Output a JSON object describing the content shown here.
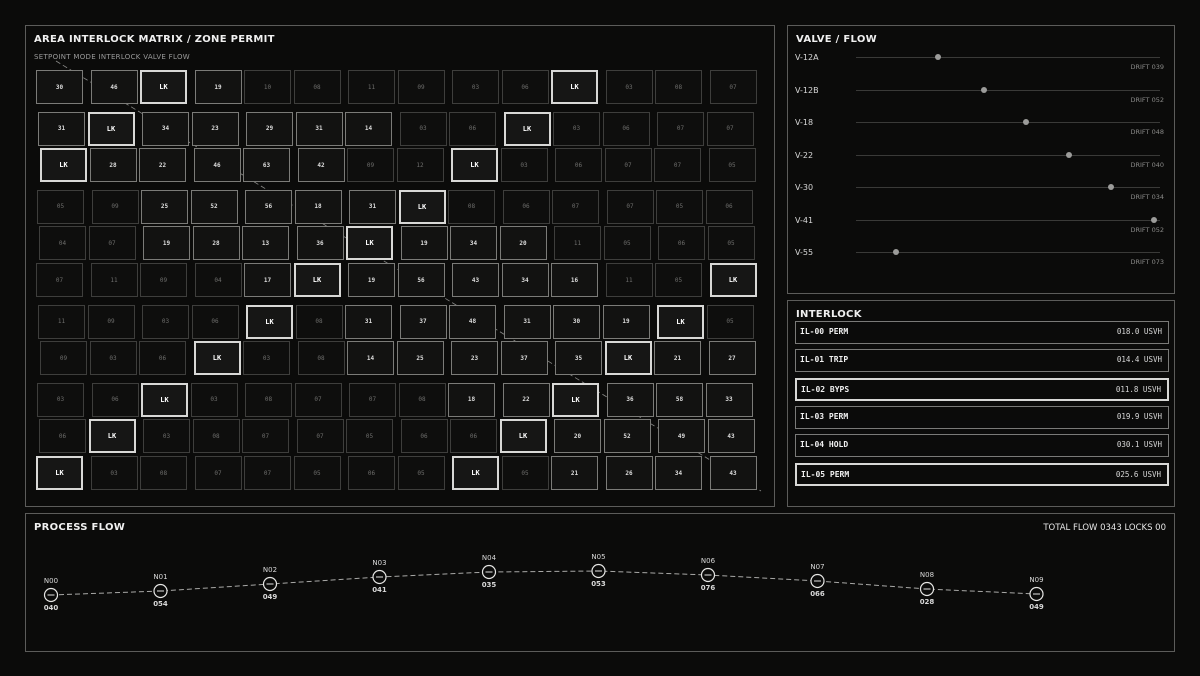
{
  "matrix": {
    "title": "AREA INTERLOCK MATRIX / ZONE PERMIT",
    "subtitle": "SETPOINT  MODE  INTERLOCK  VALVE  FLOW",
    "rows": [
      [
        "30",
        "46",
        "LK",
        "19",
        "10",
        "08",
        "11",
        "09",
        "03",
        "06",
        "LK",
        "03",
        "08",
        "07"
      ],
      [
        "31",
        "LK",
        "34",
        "23",
        "29",
        "31",
        "14",
        "03",
        "06",
        "LK",
        "03",
        "06",
        "07",
        "07"
      ],
      [
        "LK",
        "28",
        "22",
        "46",
        "63",
        "42",
        "09",
        "12",
        "LK",
        "03",
        "06",
        "07",
        "07",
        "05"
      ],
      [
        "05",
        "09",
        "25",
        "52",
        "56",
        "18",
        "31",
        "LK",
        "08",
        "06",
        "07",
        "07",
        "05",
        "06"
      ],
      [
        "04",
        "07",
        "19",
        "28",
        "13",
        "36",
        "LK",
        "19",
        "34",
        "20",
        "11",
        "05",
        "06",
        "05"
      ],
      [
        "07",
        "11",
        "09",
        "04",
        "17",
        "LK",
        "19",
        "56",
        "43",
        "34",
        "16",
        "11",
        "05",
        "LK"
      ],
      [
        "11",
        "09",
        "03",
        "06",
        "LK",
        "08",
        "31",
        "37",
        "48",
        "31",
        "30",
        "19",
        "LK",
        "05"
      ],
      [
        "09",
        "03",
        "06",
        "LK",
        "03",
        "08",
        "14",
        "25",
        "23",
        "37",
        "35",
        "LK",
        "21",
        "27"
      ],
      [
        "03",
        "06",
        "LK",
        "03",
        "08",
        "07",
        "07",
        "08",
        "18",
        "22",
        "LK",
        "36",
        "58",
        "33"
      ],
      [
        "06",
        "LK",
        "03",
        "08",
        "07",
        "07",
        "05",
        "06",
        "06",
        "LK",
        "20",
        "52",
        "49",
        "43"
      ],
      [
        "LK",
        "03",
        "08",
        "07",
        "07",
        "05",
        "06",
        "05",
        "LK",
        "05",
        "21",
        "26",
        "34",
        "43"
      ]
    ]
  },
  "valve": {
    "title": "VALVE / FLOW",
    "items": [
      {
        "name": "V-12A",
        "position": 0.27,
        "drift": "DRIFT 039"
      },
      {
        "name": "V-12B",
        "position": 0.42,
        "drift": "DRIFT 052"
      },
      {
        "name": "V-18",
        "position": 0.56,
        "drift": "DRIFT 048"
      },
      {
        "name": "V-22",
        "position": 0.7,
        "drift": "DRIFT 040"
      },
      {
        "name": "V-30",
        "position": 0.84,
        "drift": "DRIFT 034"
      },
      {
        "name": "V-41",
        "position": 0.98,
        "drift": "DRIFT 052"
      },
      {
        "name": "V-55",
        "position": 0.13,
        "drift": "DRIFT 073"
      }
    ]
  },
  "interlock": {
    "title": "INTERLOCK",
    "items": [
      {
        "name": "IL-00 PERM",
        "value": "018.0 USVH",
        "emphasis": false
      },
      {
        "name": "IL-01 TRIP",
        "value": "014.4 USVH",
        "emphasis": false
      },
      {
        "name": "IL-02 BYPS",
        "value": "011.8 USVH",
        "emphasis": true
      },
      {
        "name": "IL-03 PERM",
        "value": "019.9 USVH",
        "emphasis": false
      },
      {
        "name": "IL-04 HOLD",
        "value": "030.1 USVH",
        "emphasis": false
      },
      {
        "name": "IL-05 PERM",
        "value": "025.6 USVH",
        "emphasis": true
      }
    ]
  },
  "flow": {
    "title": "PROCESS FLOW",
    "summary": "TOTAL FLOW 0343   LOCKS 00",
    "nodes": [
      {
        "id": "N00",
        "value": "040"
      },
      {
        "id": "N01",
        "value": "054"
      },
      {
        "id": "N02",
        "value": "049"
      },
      {
        "id": "N03",
        "value": "041"
      },
      {
        "id": "N04",
        "value": "035"
      },
      {
        "id": "N05",
        "value": "053"
      },
      {
        "id": "N06",
        "value": "076"
      },
      {
        "id": "N07",
        "value": "066"
      },
      {
        "id": "N08",
        "value": "028"
      },
      {
        "id": "N09",
        "value": "049"
      }
    ]
  }
}
